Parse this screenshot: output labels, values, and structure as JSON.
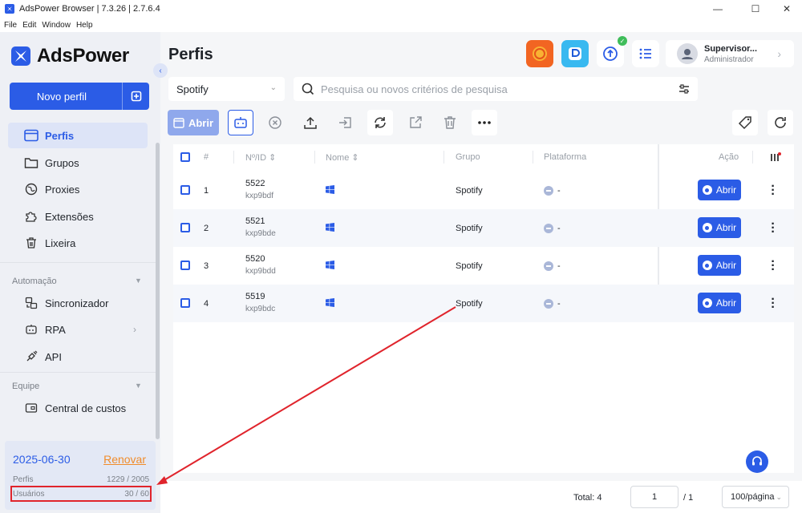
{
  "window": {
    "title": "AdsPower Browser | 7.3.26 | 2.7.6.4",
    "menu": [
      "File",
      "Edit",
      "Window",
      "Help"
    ]
  },
  "sidebar": {
    "logo_text": "AdsPower",
    "new_profile_label": "Novo perfil",
    "nav": {
      "perfis": "Perfis",
      "grupos": "Grupos",
      "proxies": "Proxies",
      "extensoes": "Extensões",
      "lixeira": "Lixeira"
    },
    "automation_label": "Automação",
    "automation": {
      "sincronizador": "Sincronizador",
      "rpa": "RPA",
      "api": "API"
    },
    "team_label": "Equipe",
    "team": {
      "central": "Central de custos"
    },
    "plan": {
      "date": "2025-06-30",
      "renew": "Renovar",
      "profiles_label": "Perfis",
      "profiles_value": "1229 / 2005",
      "users_label": "Usuários",
      "users_value": "30 / 60"
    }
  },
  "header": {
    "page_title": "Perfis",
    "user_name": "Supervisor...",
    "user_role": "Administrador"
  },
  "filters": {
    "group_value": "Spotify",
    "search_placeholder": "Pesquisa ou novos critérios de pesquisa"
  },
  "toolbar": {
    "open_label": "Abrir"
  },
  "table": {
    "headers": {
      "num": "#",
      "id": "Nº/ID ⇕",
      "name": "Nome ⇕",
      "group": "Grupo",
      "platform": "Plataforma",
      "action": "Ação"
    },
    "rows": [
      {
        "n": "1",
        "id": "5522",
        "code": "kxp9bdf",
        "group": "Spotify",
        "platform": "-",
        "action": "Abrir"
      },
      {
        "n": "2",
        "id": "5521",
        "code": "kxp9bde",
        "group": "Spotify",
        "platform": "-",
        "action": "Abrir"
      },
      {
        "n": "3",
        "id": "5520",
        "code": "kxp9bdd",
        "group": "Spotify",
        "platform": "-",
        "action": "Abrir"
      },
      {
        "n": "4",
        "id": "5519",
        "code": "kxp9bdc",
        "group": "Spotify",
        "platform": "-",
        "action": "Abrir"
      }
    ]
  },
  "pagination": {
    "total": "Total: 4",
    "page": "1",
    "of": "/ 1",
    "per_page": "100/página"
  },
  "colors": {
    "accent": "#2b5ce6",
    "annotation": "#e0242c",
    "renew": "#f08c2b"
  }
}
